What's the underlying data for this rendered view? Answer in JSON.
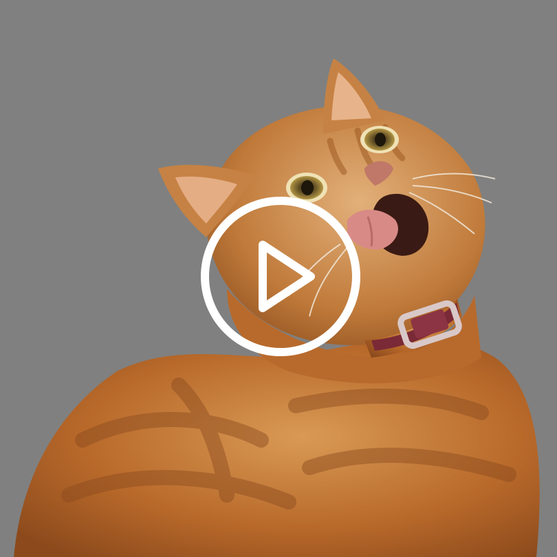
{
  "video": {
    "thumbnail_subject": "cat-icon",
    "play_icon": "play-icon",
    "overlay_color": "#808080",
    "play_color": "#ffffff",
    "fur_color": "#c9782e",
    "collar_color": "#7a2a36"
  }
}
